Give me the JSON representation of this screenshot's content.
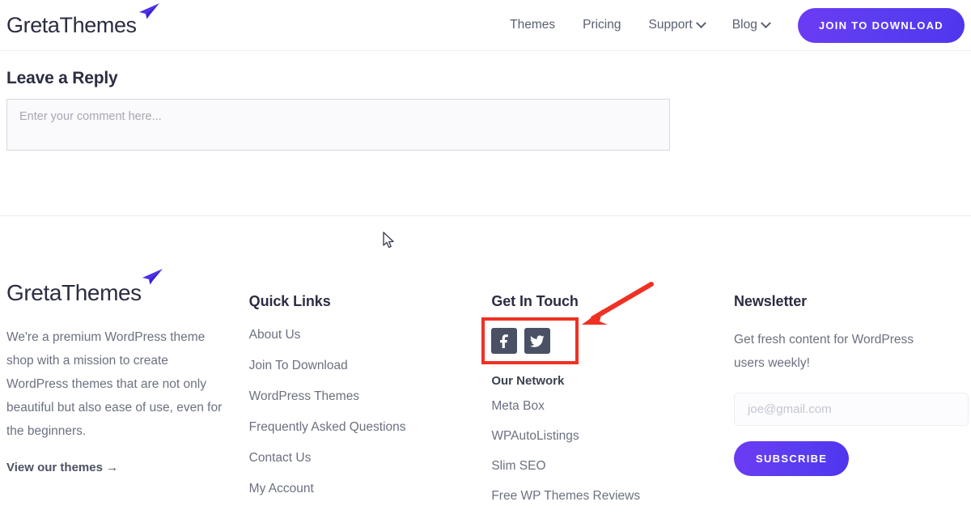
{
  "header": {
    "logo_text": "GretaThemes",
    "logo_icon": "paper-plane-icon",
    "nav": [
      {
        "label": "Themes",
        "has_chevron": false
      },
      {
        "label": "Pricing",
        "has_chevron": false
      },
      {
        "label": "Support",
        "has_chevron": true
      },
      {
        "label": "Blog",
        "has_chevron": true
      }
    ],
    "cta_label": "JOIN TO DOWNLOAD"
  },
  "reply": {
    "title": "Leave a Reply",
    "comment_placeholder": "Enter your comment here...",
    "comment_value": ""
  },
  "footer": {
    "brand": {
      "logo_text": "GretaThemes",
      "description": "We're a premium WordPress theme shop with a mission to create WordPress themes that are not only beautiful but also ease of use, even for the beginners.",
      "view_link": "View our themes →"
    },
    "quick_links": {
      "heading": "Quick Links",
      "items": [
        "About Us",
        "Join To Download",
        "WordPress Themes",
        "Frequently Asked Questions",
        "Contact Us",
        "My Account"
      ]
    },
    "get_in_touch": {
      "heading": "Get In Touch",
      "socials": [
        {
          "name": "facebook-icon",
          "label": "Facebook"
        },
        {
          "name": "twitter-icon",
          "label": "Twitter"
        }
      ],
      "network_heading": "Our Network",
      "network_items": [
        "Meta Box",
        "WPAutoListings",
        "Slim SEO",
        "Free WP Themes Reviews"
      ]
    },
    "newsletter": {
      "heading": "Newsletter",
      "description": "Get fresh content for WordPress users weekly!",
      "email_placeholder": "joe@gmail.com",
      "email_value": "",
      "subscribe_label": "SUBSCRIBE"
    }
  },
  "annotation": {
    "highlight_color": "#ef3124",
    "target": "social-media-icons"
  },
  "colors": {
    "brand_purple": "#5a3df0",
    "text_dark": "#2b2d42",
    "text_muted": "#6b7180",
    "social_bg": "#4a5165"
  }
}
